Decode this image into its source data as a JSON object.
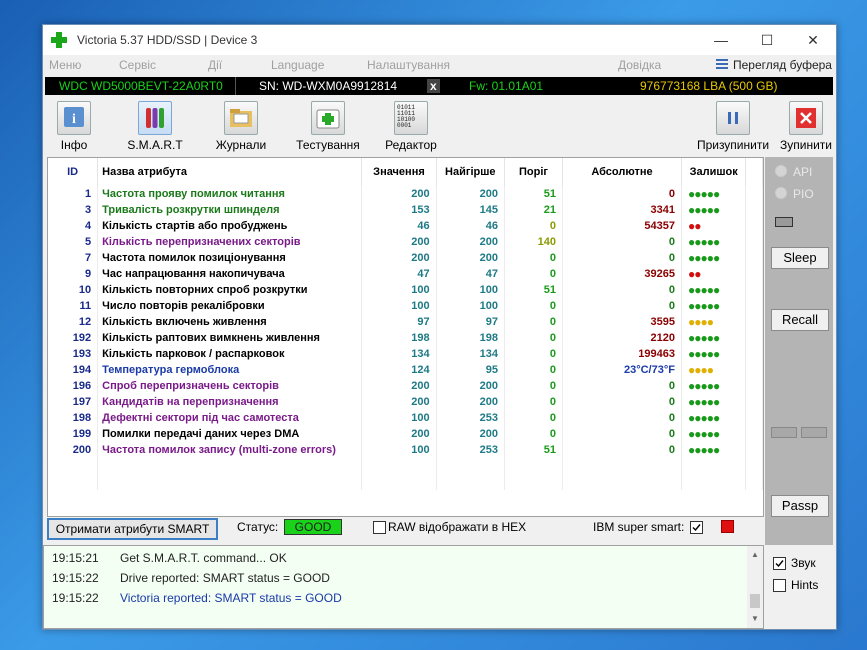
{
  "window": {
    "title": "Victoria 5.37 HDD/SSD | Device 3",
    "minimize": "—",
    "maximize": "☐",
    "close": "✕"
  },
  "menu": [
    "Меню",
    "Сервіс",
    "Дії",
    "Language",
    "Налаштування",
    "Довідка"
  ],
  "buffer_view": "Перегляд буфера",
  "info": {
    "model": "WDC WD5000BEVT-22A0RT0",
    "serial": "SN: WD-WXM0A9912814",
    "close_x": "x",
    "firmware": "Fw: 01.01A01",
    "lba": "976773168 LBA (500 GB)"
  },
  "toolbar": {
    "info": "Інфо",
    "smart": "S.M.A.R.T",
    "logs": "Журнали",
    "tests": "Тестування",
    "editor": "Редактор",
    "pause": "Призупинити",
    "stop": "Зупинити",
    "editor_icon_text": "01011\n11011\n10100\n0001"
  },
  "columns": {
    "id": "ID",
    "name": "Назва атрибута",
    "value": "Значення",
    "worst": "Найгірше",
    "threshold": "Поріг",
    "absolute": "Абсолютне",
    "remaining": "Залишок"
  },
  "rows": [
    {
      "id": "1",
      "name": "Частота прояву помилок читання",
      "value": "200",
      "worst": "200",
      "threshold": "51",
      "absolute": "0",
      "remaining": "●●●●●",
      "name_color": "green",
      "rem_color": "#1a9a1a",
      "thr_color": "green",
      "abs_color": "#8b0000"
    },
    {
      "id": "3",
      "name": "Тривалість розкрутки шпинделя",
      "value": "153",
      "worst": "145",
      "threshold": "21",
      "absolute": "3341",
      "remaining": "●●●●●",
      "name_color": "green",
      "rem_color": "#1a9a1a",
      "thr_color": "green",
      "abs_color": "#8b0000"
    },
    {
      "id": "4",
      "name": "Кількість стартів або пробуджень",
      "value": "46",
      "worst": "46",
      "threshold": "0",
      "absolute": "54357",
      "remaining": "●●",
      "name_color": "black",
      "rem_color": "#d01010",
      "thr_color": "yellow",
      "abs_color": "#8b0000"
    },
    {
      "id": "5",
      "name": "Кількість перепризначених секторів",
      "value": "200",
      "worst": "200",
      "threshold": "140",
      "absolute": "0",
      "remaining": "●●●●●",
      "name_color": "purple",
      "rem_color": "#1a9a1a",
      "thr_color": "yellow",
      "abs_color": "#1a7a1a"
    },
    {
      "id": "7",
      "name": "Частота помилок позиціонування",
      "value": "200",
      "worst": "200",
      "threshold": "0",
      "absolute": "0",
      "remaining": "●●●●●",
      "name_color": "black",
      "rem_color": "#1a9a1a",
      "thr_color": "green",
      "abs_color": "#1a7a1a"
    },
    {
      "id": "9",
      "name": "Час напрацювання накопичувача",
      "value": "47",
      "worst": "47",
      "threshold": "0",
      "absolute": "39265",
      "remaining": "●●",
      "name_color": "black",
      "rem_color": "#d01010",
      "thr_color": "green",
      "abs_color": "#8b0000"
    },
    {
      "id": "10",
      "name": "Кількість повторних спроб розкрутки",
      "value": "100",
      "worst": "100",
      "threshold": "51",
      "absolute": "0",
      "remaining": "●●●●●",
      "name_color": "black",
      "rem_color": "#1a9a1a",
      "thr_color": "green",
      "abs_color": "#1a7a1a"
    },
    {
      "id": "11",
      "name": "Число повторів рекалібровки",
      "value": "100",
      "worst": "100",
      "threshold": "0",
      "absolute": "0",
      "remaining": "●●●●●",
      "name_color": "black",
      "rem_color": "#1a9a1a",
      "thr_color": "green",
      "abs_color": "#1a7a1a"
    },
    {
      "id": "12",
      "name": "Кількість включень живлення",
      "value": "97",
      "worst": "97",
      "threshold": "0",
      "absolute": "3595",
      "remaining": "●●●●",
      "name_color": "black",
      "rem_color": "#e0b000",
      "thr_color": "green",
      "abs_color": "#8b0000"
    },
    {
      "id": "192",
      "name": "Кількість раптових вимкнень живлення",
      "value": "198",
      "worst": "198",
      "threshold": "0",
      "absolute": "2120",
      "remaining": "●●●●●",
      "name_color": "black",
      "rem_color": "#1a9a1a",
      "thr_color": "green",
      "abs_color": "#8b0000"
    },
    {
      "id": "193",
      "name": "Кількість парковок / распарковок",
      "value": "134",
      "worst": "134",
      "threshold": "0",
      "absolute": "199463",
      "remaining": "●●●●●",
      "name_color": "black",
      "rem_color": "#1a9a1a",
      "thr_color": "green",
      "abs_color": "#8b0000"
    },
    {
      "id": "194",
      "name": "Температура гермоблока",
      "value": "124",
      "worst": "95",
      "threshold": "0",
      "absolute": "23°C/73°F",
      "remaining": "●●●●",
      "name_color": "blue",
      "rem_color": "#e0b000",
      "thr_color": "green",
      "abs_color": "#1a3aa8"
    },
    {
      "id": "196",
      "name": "Спроб перепризначень секторів",
      "value": "200",
      "worst": "200",
      "threshold": "0",
      "absolute": "0",
      "remaining": "●●●●●",
      "name_color": "purple",
      "rem_color": "#1a9a1a",
      "thr_color": "green",
      "abs_color": "#1a7a1a"
    },
    {
      "id": "197",
      "name": "Кандидатів на перепризначення",
      "value": "200",
      "worst": "200",
      "threshold": "0",
      "absolute": "0",
      "remaining": "●●●●●",
      "name_color": "purple",
      "rem_color": "#1a9a1a",
      "thr_color": "green",
      "abs_color": "#1a7a1a"
    },
    {
      "id": "198",
      "name": "Дефектні сектори під час самотеста",
      "value": "100",
      "worst": "253",
      "threshold": "0",
      "absolute": "0",
      "remaining": "●●●●●",
      "name_color": "purple",
      "rem_color": "#1a9a1a",
      "thr_color": "green",
      "abs_color": "#1a7a1a"
    },
    {
      "id": "199",
      "name": "Помилки передачі даних через DMA",
      "value": "200",
      "worst": "200",
      "threshold": "0",
      "absolute": "0",
      "remaining": "●●●●●",
      "name_color": "black",
      "rem_color": "#1a9a1a",
      "thr_color": "green",
      "abs_color": "#1a7a1a"
    },
    {
      "id": "200",
      "name": "Частота помилок запису (multi-zone errors)",
      "value": "100",
      "worst": "253",
      "threshold": "51",
      "absolute": "0",
      "remaining": "●●●●●",
      "name_color": "purple",
      "rem_color": "#1a9a1a",
      "thr_color": "green",
      "abs_color": "#1a7a1a"
    }
  ],
  "status_bar": {
    "get_button": "Отримати атрибути SMART",
    "status_label": "Статус:",
    "status_value": "GOOD",
    "raw_hex_label": "RAW відображати в HEX",
    "ibm_label": "IBM super smart:"
  },
  "right_panel": {
    "api": "API",
    "pio": "PIO",
    "sleep": "Sleep",
    "recall": "Recall",
    "passp": "Passp"
  },
  "log": [
    {
      "time": "19:15:21",
      "text": "Get S.M.A.R.T. command... OK",
      "color": "#222"
    },
    {
      "time": "19:15:22",
      "text": "Drive reported: SMART status = GOOD",
      "color": "#222"
    },
    {
      "time": "19:15:22",
      "text": "Victoria reported: SMART status = GOOD",
      "color": "#1a3aa8"
    }
  ],
  "options": {
    "sound": "Звук",
    "hints": "Hints"
  },
  "colors": {
    "info_model": "#19d219",
    "info_serial": "#ffffff",
    "info_fw": "#19d219",
    "info_lba": "#e8c800",
    "status_good": "#19d219"
  }
}
